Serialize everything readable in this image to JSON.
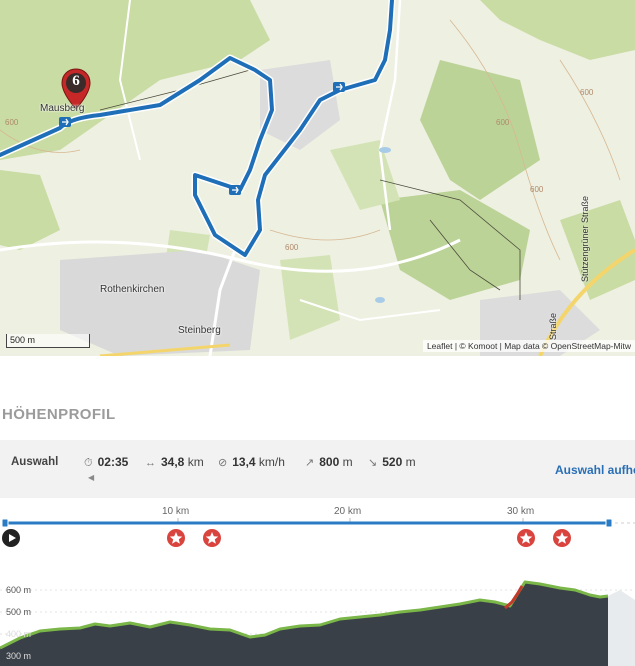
{
  "map": {
    "places": {
      "mausberg": "Mausberg",
      "rothenkirchen": "Rothenkirchen",
      "steinberg": "Steinberg"
    },
    "contours": [
      "600",
      "600",
      "600",
      "600",
      "600"
    ],
    "streets": {
      "stutzengruener": "Stützengrüner Straße",
      "strasse": "Straße"
    },
    "waypoint_number": "6",
    "scale_label": "500 m",
    "attribution": "Leaflet | © Komoot | Map data © OpenStreetMap-Mitw",
    "colors": {
      "route": "#1f6fb8",
      "forest": "#c5d9a0",
      "pin": "#c62828"
    }
  },
  "profile_title": "HÖHENPROFIL",
  "selection": {
    "label": "Auswahl",
    "duration": "02:35",
    "distance_value": "34,8",
    "distance_unit": "km",
    "speed_value": "13,4",
    "speed_unit": "km/h",
    "ascent_value": "800",
    "ascent_unit": "m",
    "descent_value": "520",
    "descent_unit": "m",
    "icons": {
      "duration": "clock-icon",
      "distance": "horizontal-arrows-icon",
      "speed": "average-speed-icon",
      "ascent": "arrow-up-right-icon",
      "descent": "arrow-down-right-icon"
    },
    "link": "Auswahl aufhe"
  },
  "elevation_profile": {
    "km_ticks": [
      "10 km",
      "20 km",
      "30 km"
    ],
    "elevation_ticks": [
      "600 m",
      "500 m",
      "400 m",
      "300 m"
    ],
    "highlight_count": 4
  }
}
